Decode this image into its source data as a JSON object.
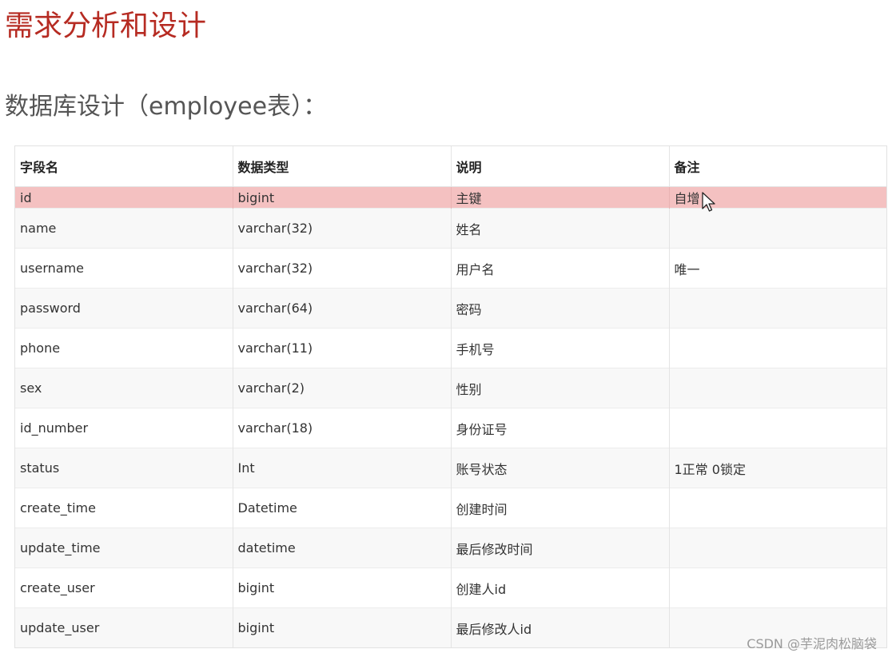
{
  "page": {
    "title": "需求分析和设计",
    "section_heading": "数据库设计（employee表）："
  },
  "table": {
    "headers": [
      "字段名",
      "数据类型",
      "说明",
      "备注"
    ],
    "rows": [
      [
        "id",
        "bigint",
        "主键",
        "自增"
      ],
      [
        "name",
        "varchar(32)",
        "姓名",
        ""
      ],
      [
        "username",
        "varchar(32)",
        "用户名",
        "唯一"
      ],
      [
        "password",
        "varchar(64)",
        "密码",
        ""
      ],
      [
        "phone",
        "varchar(11)",
        "手机号",
        ""
      ],
      [
        "sex",
        "varchar(2)",
        "性别",
        ""
      ],
      [
        "id_number",
        "varchar(18)",
        "身份证号",
        ""
      ],
      [
        "status",
        "Int",
        "账号状态",
        "1正常 0锁定"
      ],
      [
        "create_time",
        "Datetime",
        "创建时间",
        ""
      ],
      [
        "update_time",
        "datetime",
        "最后修改时间",
        ""
      ],
      [
        "create_user",
        "bigint",
        "创建人id",
        ""
      ],
      [
        "update_user",
        "bigint",
        "最后修改人id",
        ""
      ]
    ],
    "highlighted_row_index": 0
  },
  "watermark": "CSDN @芋泥肉松脑袋",
  "colors": {
    "title": "#b62b22",
    "highlight_row": "#f4c1c1"
  },
  "icons": {
    "cursor": "mouse-pointer-icon"
  }
}
